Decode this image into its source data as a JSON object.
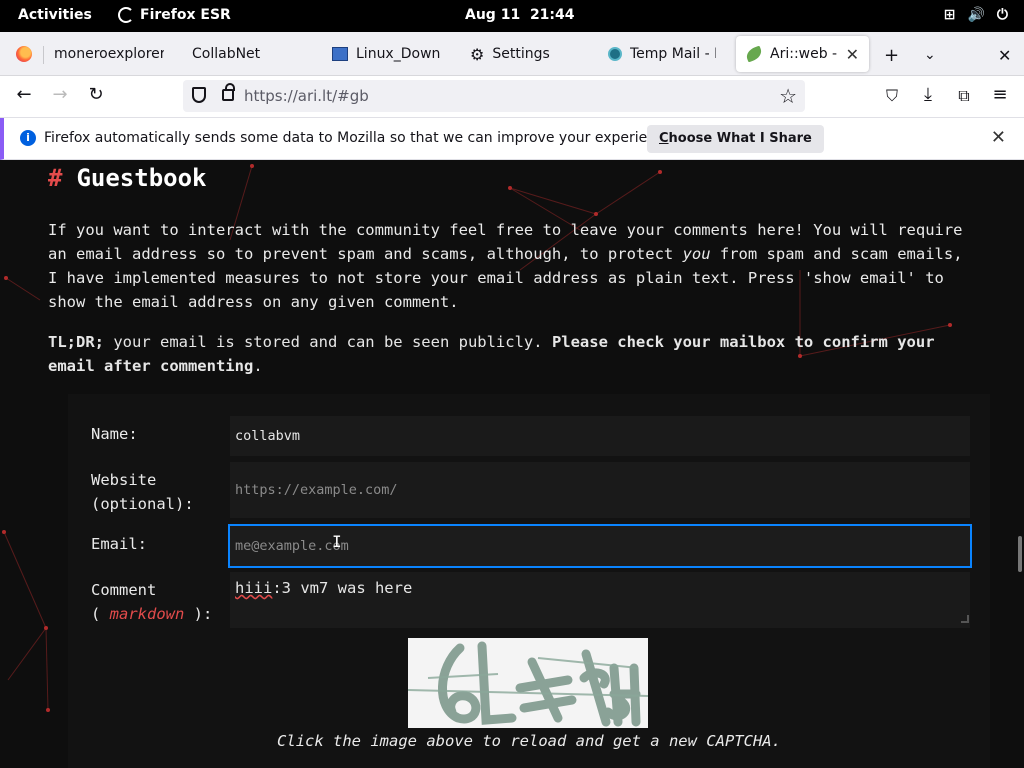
{
  "system": {
    "activities": "Activities",
    "app_name": "Firefox ESR",
    "date": "Aug 11",
    "time": "21:44"
  },
  "tabs": [
    {
      "label": "moneroexplorer.c",
      "icon": "firefox-icon"
    },
    {
      "label": "CollabNet",
      "icon": "none"
    },
    {
      "label": "Linux_Downlo",
      "icon": "window-icon"
    },
    {
      "label": "Settings",
      "icon": "gear-icon"
    },
    {
      "label": "Temp Mail - D",
      "icon": "tempmail-icon"
    },
    {
      "label": "Ari::web -> |",
      "icon": "leaf-icon",
      "active": true
    }
  ],
  "nav": {
    "url": "https://ari.lt/#gb"
  },
  "notification": {
    "message": "Firefox automatically sends some data to Mozilla so that we can improve your experience.",
    "button_prefix": "C",
    "button_rest": "hoose What I Share"
  },
  "page": {
    "heading_hash": "#",
    "heading": "Guestbook",
    "intro_1": "If you want to interact with the community feel free to leave your comments here! You will require an email address so to prevent spam and scams, although, to protect ",
    "intro_em": "you",
    "intro_2": " from spam and scam emails, I have implemented measures to not store your email address as plain text. Press 'show email' to show the email address on any given comment.",
    "tldr_prefix": "TL;DR;",
    "tldr_text": " your email is stored and can be seen publicly. ",
    "tldr_bold": "Please check your mailbox to confirm your email after commenting",
    "tldr_end": "."
  },
  "form": {
    "name_label": "Name:",
    "name_value": "collabvm",
    "website_label_1": "Website",
    "website_label_2": "(optional):",
    "website_placeholder": "https://example.com/",
    "email_label": "Email:",
    "email_placeholder": "me@example.com",
    "comment_label_1": "Comment",
    "comment_label_open": "( ",
    "comment_label_md": "markdown",
    "comment_label_close": " ):",
    "comment_spell": "hiii",
    "comment_rest": ":3 vm7 was here",
    "captcha_hint": "Click the image above to reload and get a new CAPTCHA."
  }
}
